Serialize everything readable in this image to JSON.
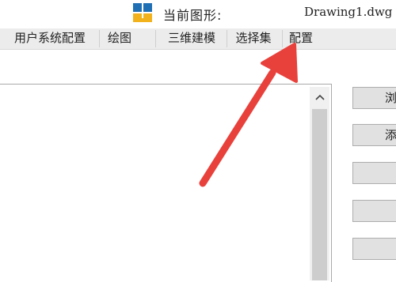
{
  "window": {
    "title_label": "当前图形:",
    "file_name": "Drawing1.dwg"
  },
  "tabs": [
    {
      "label": "用户系统配置"
    },
    {
      "label": "绘图"
    },
    {
      "label": "三维建模"
    },
    {
      "label": "选择集"
    },
    {
      "label": "配置"
    }
  ],
  "buttons": [
    {
      "label": "浏"
    },
    {
      "label": "添"
    },
    {
      "label": ""
    },
    {
      "label": ""
    },
    {
      "label": ""
    }
  ],
  "colors": {
    "arrow": "#e8413c",
    "tabbar": "#ececec",
    "button": "#e1e1e1"
  }
}
